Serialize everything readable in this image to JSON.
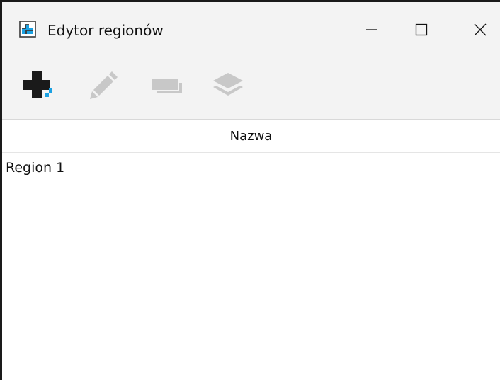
{
  "window": {
    "title": "Edytor regionów",
    "app_icon": "region-editor-app-icon",
    "controls": {
      "minimize_icon": "minimize-icon",
      "maximize_icon": "maximize-icon",
      "close_icon": "close-icon"
    }
  },
  "toolbar": {
    "buttons": [
      {
        "id": "add",
        "icon": "add-plus-icon",
        "enabled": true
      },
      {
        "id": "edit",
        "icon": "pencil-icon",
        "enabled": false
      },
      {
        "id": "duplicate",
        "icon": "duplicate-icon",
        "enabled": false
      },
      {
        "id": "layers",
        "icon": "layers-icon",
        "enabled": false
      }
    ]
  },
  "table": {
    "columns": [
      "Nazwa"
    ],
    "rows": [
      {
        "name": "Region 1"
      }
    ]
  },
  "colors": {
    "accent": "#1ba1e2",
    "icon_dark": "#1a1a1a",
    "icon_disabled": "#c8c8c8",
    "chrome_background": "#f3f3f3"
  }
}
